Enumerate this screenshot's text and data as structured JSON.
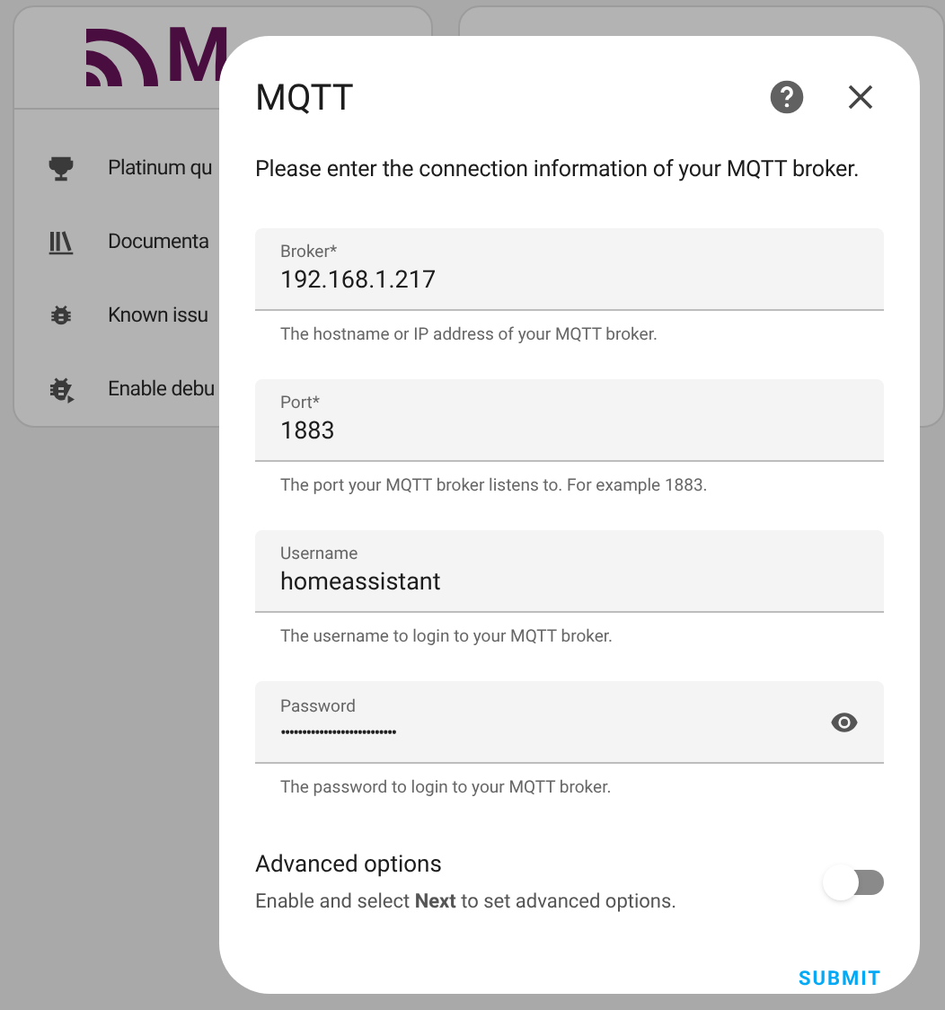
{
  "background_card": {
    "logo_text": "M",
    "items": [
      {
        "kind": "trophy",
        "label": "Platinum qu"
      },
      {
        "kind": "books",
        "label": "Documenta"
      },
      {
        "kind": "bug",
        "label": "Known issu"
      },
      {
        "kind": "bug-play",
        "label": "Enable debu"
      }
    ]
  },
  "dialog": {
    "title": "MQTT",
    "intro": "Please enter the connection information of your MQTT broker.",
    "fields": [
      {
        "kind": "text",
        "label": "Broker*",
        "value": "192.168.1.217",
        "helper": "The hostname or IP address of your MQTT broker."
      },
      {
        "kind": "text",
        "label": "Port*",
        "value": "1883",
        "helper": "The port your MQTT broker listens to. For example 1883."
      },
      {
        "kind": "text",
        "label": "Username",
        "value": "homeassistant",
        "helper": "The username to login to your MQTT broker."
      },
      {
        "kind": "password",
        "label": "Password",
        "value": "•••••••••••••••••••••••••••",
        "helper": "The password to login to your MQTT broker."
      }
    ],
    "advanced": {
      "title": "Advanced options",
      "description": "Enable and select **Next** to set advanced options.",
      "on": false
    },
    "submit": "SUBMIT"
  }
}
